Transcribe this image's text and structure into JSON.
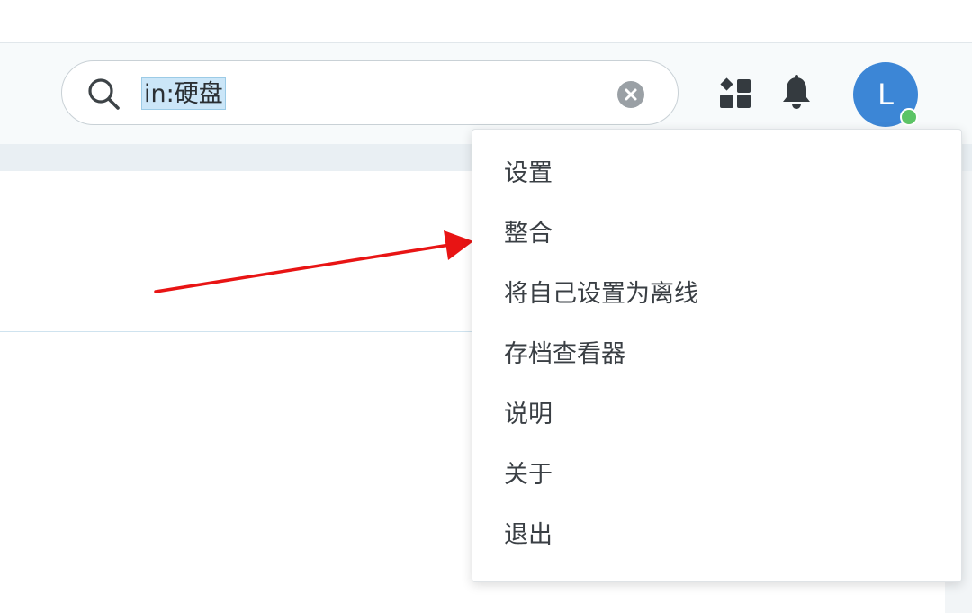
{
  "search": {
    "query": "in:硬盘"
  },
  "user": {
    "avatar_initial": "L"
  },
  "menu": {
    "items": [
      {
        "label": "设置"
      },
      {
        "label": "整合"
      },
      {
        "label": "将自己设置为离线"
      },
      {
        "label": "存档查看器"
      },
      {
        "label": "说明"
      },
      {
        "label": "关于"
      },
      {
        "label": "退出"
      }
    ]
  },
  "colors": {
    "avatar_bg": "#3c86d6",
    "presence_online": "#5cc466",
    "annotation_arrow": "#e81414",
    "search_highlight": "#cbe6f8"
  },
  "icons": [
    "search-icon",
    "clear-icon",
    "apps-icon",
    "bell-icon"
  ]
}
